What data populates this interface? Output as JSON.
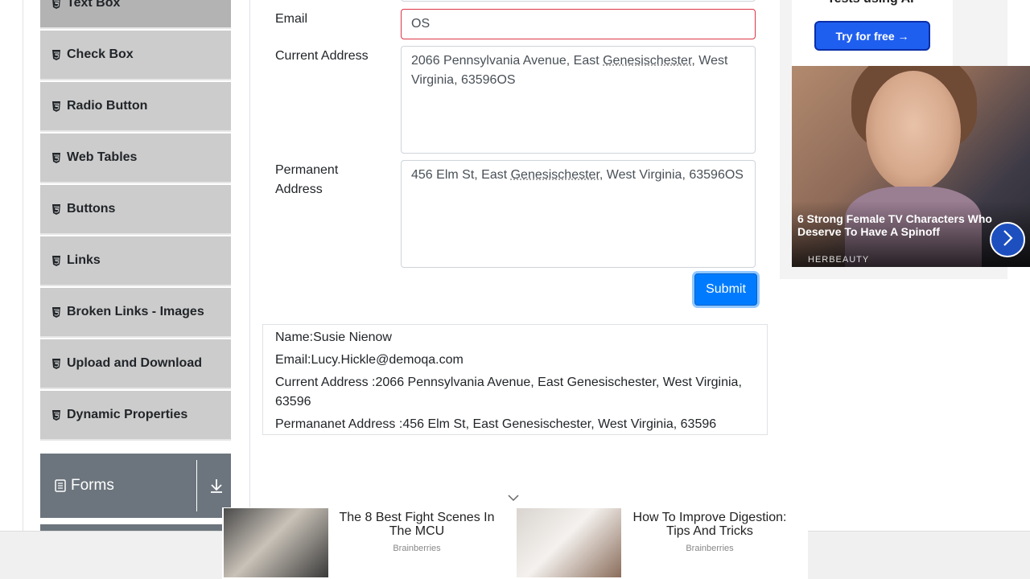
{
  "sidebar": {
    "items": [
      {
        "label": "Text Box",
        "icon": "html5-icon"
      },
      {
        "label": "Check Box",
        "icon": "html5-icon"
      },
      {
        "label": "Radio Button",
        "icon": "html5-icon"
      },
      {
        "label": "Web Tables",
        "icon": "html5-icon"
      },
      {
        "label": "Buttons",
        "icon": "html5-icon"
      },
      {
        "label": "Links",
        "icon": "html5-icon"
      },
      {
        "label": "Broken Links - Images",
        "icon": "html5-icon"
      },
      {
        "label": "Upload and Download",
        "icon": "html5-icon"
      },
      {
        "label": "Dynamic Properties",
        "icon": "html5-icon"
      }
    ],
    "group": {
      "label": "Forms",
      "icon": "document-icon",
      "toggle_icon": "download-arrow-icon"
    }
  },
  "form": {
    "email_label": "Email",
    "email_value": "OS",
    "current_address_label": "Current Address",
    "current_address_value_pre": "2066 Pennsylvania Avenue, East ",
    "current_address_value_spell": "Genesischester",
    "current_address_value_post": ", West Virginia, 63596OS",
    "permanent_address_label_line1": "Permanent",
    "permanent_address_label_line2": "Address",
    "permanent_address_value_pre": "456 Elm St, East ",
    "permanent_address_value_spell": "Genesischester",
    "permanent_address_value_post": ", West Virginia, 63596OS",
    "submit_label": "Submit"
  },
  "output": {
    "name": "Name:Susie Nienow",
    "email": "Email:Lucy.Hickle@demoqa.com",
    "current_address": "Current Address :2066 Pennsylvania Avenue, East Genesischester, West Virginia, 63596",
    "permanent_address": "Permananet Address :456 Elm St, East Genesischester, West Virginia, 63596"
  },
  "ad_right": {
    "top_text": "Tests using AI",
    "button_label": "Try for free →",
    "headline": "6 Strong Female TV Characters Who Deserve To Have A Spinoff",
    "source": "HERBEAUTY"
  },
  "bottom_ads": [
    {
      "title": "The 8 Best Fight Scenes In The MCU",
      "source": "Brainberries"
    },
    {
      "title": "How To Improve Digestion: Tips And Tricks",
      "source": "Brainberries"
    }
  ],
  "colors": {
    "primary": "#007bff",
    "error": "#dc3545",
    "menu_bg": "#cccccc",
    "group_bg": "#6c757d"
  }
}
